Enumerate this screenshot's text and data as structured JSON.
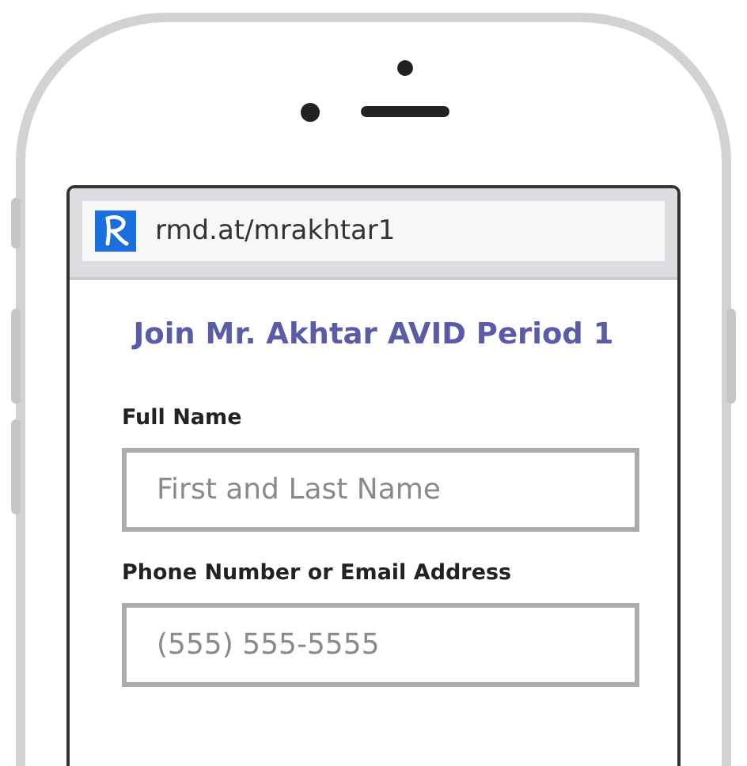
{
  "address_bar": {
    "url": "rmd.at/mrakhtar1"
  },
  "form": {
    "title": "Join Mr. Akhtar AVID Period 1",
    "fields": [
      {
        "label": "Full Name",
        "placeholder": "First and Last Name"
      },
      {
        "label": "Phone Number or Email Address",
        "placeholder": "(555) 555-5555"
      }
    ]
  }
}
